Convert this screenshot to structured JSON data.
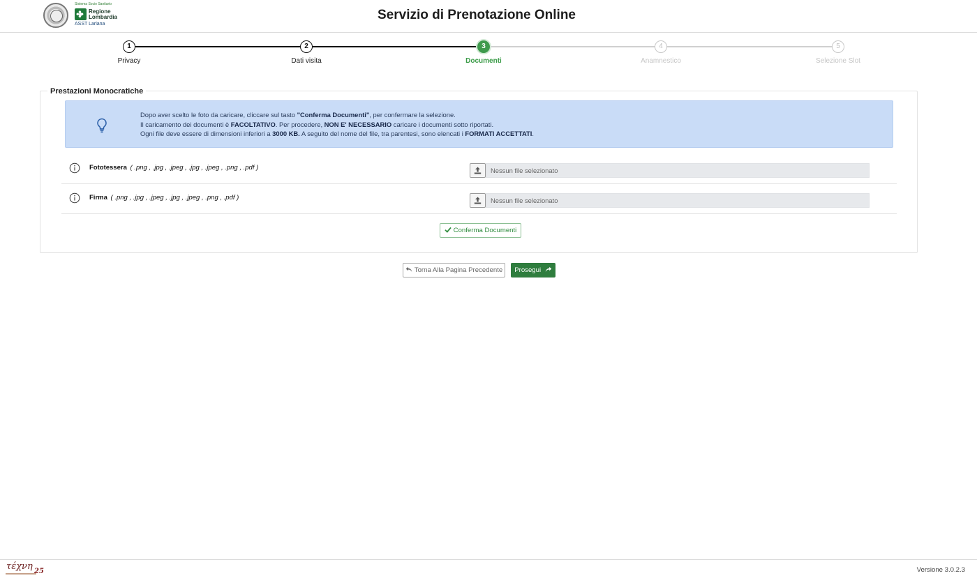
{
  "header": {
    "title": "Servizio di Prenotazione Online",
    "logo_small_text": "Sistema Socio Sanitario",
    "logo_name_line1": "Regione",
    "logo_name_line2": "Lombardia",
    "logo_subtitle": "ASST Lariana"
  },
  "stepper": {
    "steps": [
      {
        "number": "1",
        "label": "Privacy",
        "state": "done"
      },
      {
        "number": "2",
        "label": "Dati visita",
        "state": "done"
      },
      {
        "number": "3",
        "label": "Documenti",
        "state": "active"
      },
      {
        "number": "4",
        "label": "Anamnestico",
        "state": "pending"
      },
      {
        "number": "5",
        "label": "Selezione Slot",
        "state": "pending"
      }
    ]
  },
  "panel": {
    "legend": "Prestazioni Monocratiche",
    "info": {
      "l1_a": "Dopo aver scelto le foto da caricare, cliccare sul tasto ",
      "l1_b": "\"Conferma Documenti\"",
      "l1_c": ", per confermare la selezione.",
      "l2_a": "Il caricamento dei documenti è ",
      "l2_b": "FACOLTATIVO",
      "l2_c": ". Per procedere, ",
      "l2_d": "NON E' NECESSARIO",
      "l2_e": " caricare i documenti sotto riportati.",
      "l3_a": "Ogni file deve essere di dimensioni inferiori a ",
      "l3_b": "3000 KB.",
      "l3_c": " A seguito del nome del file, tra parentesi, sono elencati i ",
      "l3_d": "FORMATI ACCETTATI",
      "l3_e": "."
    },
    "documents": [
      {
        "name": "Fototessera",
        "formats": "( .png , .jpg , .jpeg , .jpg , .jpeg , .png , .pdf )",
        "file_placeholder": "Nessun file selezionato"
      },
      {
        "name": "Firma",
        "formats": "( .png , .jpg , .jpeg , .jpg , .jpeg , .png , .pdf )",
        "file_placeholder": "Nessun file selezionato"
      }
    ],
    "confirm_label": "Conferma Documenti"
  },
  "navigation": {
    "back_label": "Torna Alla Pagina Precedente",
    "next_label": "Prosegui"
  },
  "footer": {
    "logo_text": "τέχνη",
    "logo_number": "25",
    "version": "Versione 3.0.2.3"
  },
  "colors": {
    "accent_green": "#3f9a4d",
    "info_blue": "#c9dcf7",
    "primary_button": "#2f7d3e"
  },
  "icons": {
    "info_box": "lightbulb-icon",
    "document_row": "info-circle-icon",
    "upload": "upload-icon",
    "confirm": "check-icon",
    "back": "reply-arrow-icon",
    "next": "share-arrow-icon"
  }
}
